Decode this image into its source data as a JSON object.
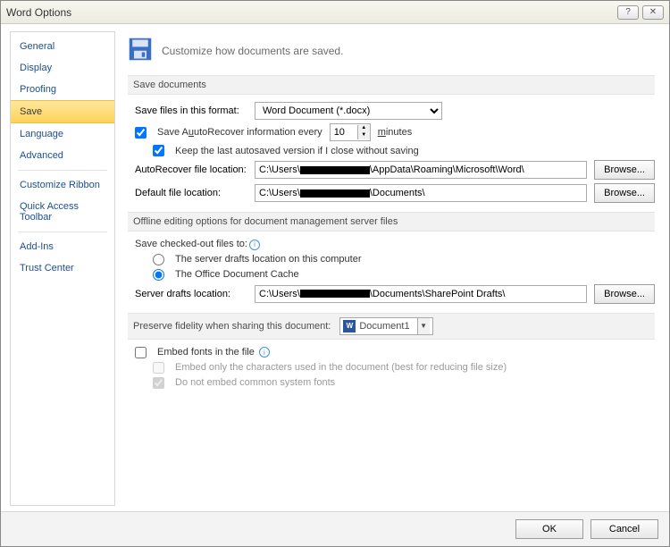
{
  "title": "Word Options",
  "header": "Customize how documents are saved.",
  "sidebar": {
    "items": [
      "General",
      "Display",
      "Proofing",
      "Save",
      "Language",
      "Advanced",
      "Customize Ribbon",
      "Quick Access Toolbar",
      "Add-Ins",
      "Trust Center"
    ],
    "selected_index": 3
  },
  "save_documents": {
    "heading": "Save documents",
    "format_label": "Save files in this format:",
    "format_value": "Word Document (*.docx)",
    "autorecover_checked": true,
    "autorecover_label_pre": "Save ",
    "autorecover_label_mid": "utoRecover information every",
    "autorecover_minutes": "10",
    "minutes_label": "inutes",
    "keep_last_checked": true,
    "keep_last_label": "Keep the last autosaved version if I close without saving",
    "autorec_loc_label": "AutoRecover file location:",
    "autorec_loc_prefix": "C:\\Users\\",
    "autorec_loc_suffix": "\\AppData\\Roaming\\Microsoft\\Word\\",
    "default_loc_label": "Default file location:",
    "default_loc_prefix": "C:\\Users\\",
    "default_loc_suffix": "\\Documents\\",
    "browse": "Browse..."
  },
  "offline": {
    "heading": "Offline editing options for document management server files",
    "save_checked_label": "Save checked-out files to:",
    "radio1": "The server drafts location on this computer",
    "radio2": "The Office Document Cache",
    "radio_selected": "cache",
    "drafts_label": "Server drafts location:",
    "drafts_prefix": "C:\\Users\\",
    "drafts_suffix": "\\Documents\\SharePoint Drafts\\",
    "browse": "Browse..."
  },
  "fidelity": {
    "heading": "Preserve fidelity when sharing this document:",
    "doc_name": "Document1",
    "embed_checked": false,
    "embed_label": "Embed fonts in the file",
    "embed_sub1_checked": false,
    "embed_sub1": "Embed only the characters used in the document (best for reducing file size)",
    "embed_sub2_checked": true,
    "embed_sub2": "Do not embed common system fonts"
  },
  "buttons": {
    "ok": "OK",
    "cancel": "Cancel"
  }
}
